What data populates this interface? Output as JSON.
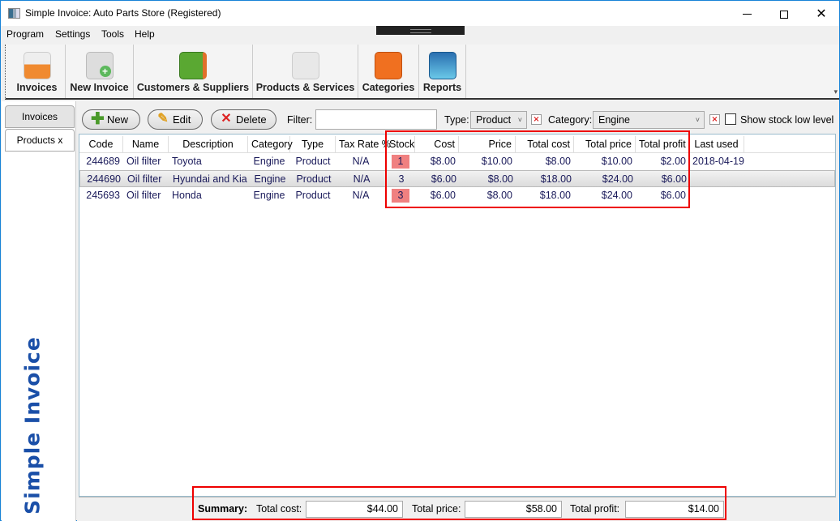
{
  "window": {
    "title": "Simple Invoice: Auto Parts Store (Registered)",
    "minimize_icon": "minimize-icon",
    "maximize_icon": "maximize-icon",
    "close_glyph": "✕"
  },
  "menu": [
    "Program",
    "Settings",
    "Tools",
    "Help"
  ],
  "toolbar": [
    {
      "label": "Invoices",
      "icon": "invoices-icon"
    },
    {
      "label": "New Invoice",
      "icon": "new-invoice-icon"
    },
    {
      "label": "Customers & Suppliers",
      "icon": "address-book-icon"
    },
    {
      "label": "Products & Services",
      "icon": "shopping-cart-icon"
    },
    {
      "label": "Categories",
      "icon": "hierarchy-icon"
    },
    {
      "label": "Reports",
      "icon": "chart-icon"
    }
  ],
  "sidebar": {
    "tabs": [
      {
        "label": "Invoices",
        "active": false
      },
      {
        "label": "Products  x",
        "active": true
      }
    ],
    "brand": "Simple Invoice"
  },
  "actions": {
    "new": "New",
    "edit": "Edit",
    "delete": "Delete",
    "new_glyph": "✚",
    "edit_glyph": "✎",
    "delete_glyph": "✕"
  },
  "filters": {
    "filter_label": "Filter:",
    "filter_value": "",
    "type_label": "Type:",
    "type_value": "Product",
    "category_label": "Category:",
    "category_value": "Engine",
    "clear_glyph": "×",
    "dropdown_glyph": "˅",
    "show_stock_low_label": "Show stock low level",
    "show_stock_low_checked": false
  },
  "table": {
    "columns": [
      "Code",
      "Name",
      "Description",
      "Category",
      "Type",
      "Tax Rate %",
      "Stock",
      "Cost",
      "Price",
      "Total cost",
      "Total price",
      "Total profit",
      "Last used"
    ],
    "rows": [
      {
        "code": "244689",
        "name": "Oil filter",
        "description": "Toyota",
        "category": "Engine",
        "type": "Product",
        "tax": "N/A",
        "stock": "1",
        "stock_low": true,
        "cost": "$8.00",
        "price": "$10.00",
        "total_cost": "$8.00",
        "total_price": "$10.00",
        "total_profit": "$2.00",
        "last_used": "2018-04-19",
        "selected": false
      },
      {
        "code": "244690",
        "name": "Oil filter",
        "description": "Hyundai and Kia",
        "category": "Engine",
        "type": "Product",
        "tax": "N/A",
        "stock": "3",
        "stock_low": false,
        "cost": "$6.00",
        "price": "$8.00",
        "total_cost": "$18.00",
        "total_price": "$24.00",
        "total_profit": "$6.00",
        "last_used": "",
        "selected": true
      },
      {
        "code": "245693",
        "name": "Oil filter",
        "description": "Honda",
        "category": "Engine",
        "type": "Product",
        "tax": "N/A",
        "stock": "3",
        "stock_low": true,
        "cost": "$6.00",
        "price": "$8.00",
        "total_cost": "$18.00",
        "total_price": "$24.00",
        "total_profit": "$6.00",
        "last_used": "",
        "selected": false
      }
    ]
  },
  "summary": {
    "title": "Summary:",
    "total_cost_label": "Total cost:",
    "total_cost": "$44.00",
    "total_price_label": "Total price:",
    "total_price": "$58.00",
    "total_profit_label": "Total profit:",
    "total_profit": "$14.00"
  },
  "colors": {
    "stock_low_highlight": "#f08080",
    "annotation_box": "#e00000",
    "brand_text": "#1a4fa8"
  }
}
